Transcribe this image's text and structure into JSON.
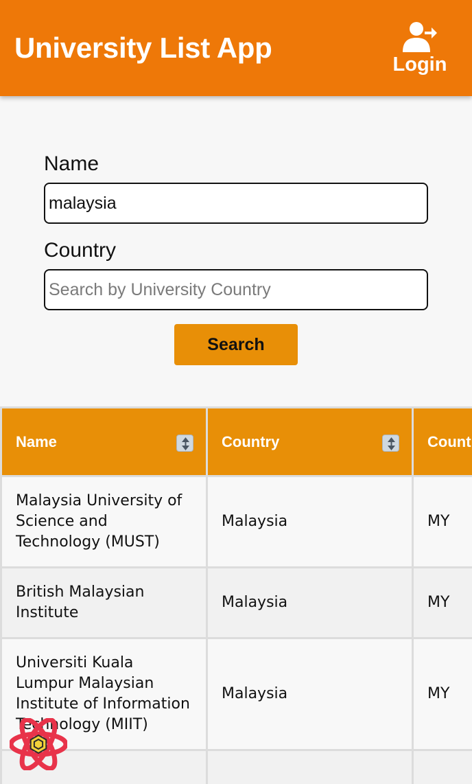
{
  "header": {
    "title": "University List App",
    "login_label": "Login",
    "login_icon": "user-logout-icon",
    "color": "#ee7808"
  },
  "form": {
    "name_label": "Name",
    "name_value": "malaysia",
    "country_label": "Country",
    "country_placeholder": "Search by University Country",
    "search_label": "Search"
  },
  "table": {
    "columns": [
      {
        "label": "Name",
        "sort_icon": "sort-up-down-icon"
      },
      {
        "label": "Country",
        "sort_icon": "sort-up-down-icon"
      },
      {
        "label": "Country Code"
      }
    ],
    "rows": [
      {
        "name": "Malaysia University of Science and Technology (MUST)",
        "country": "Malaysia",
        "code": "MY"
      },
      {
        "name": "British Malaysian Institute",
        "country": "Malaysia",
        "code": "MY"
      },
      {
        "name": "Universiti Kuala Lumpur Malaysian Institute of Information Technology (MIIT)",
        "country": "Malaysia",
        "code": "MY"
      }
    ],
    "header_color": "#e88f07"
  },
  "overlay": {
    "badge_icon": "react-devtools-icon"
  }
}
